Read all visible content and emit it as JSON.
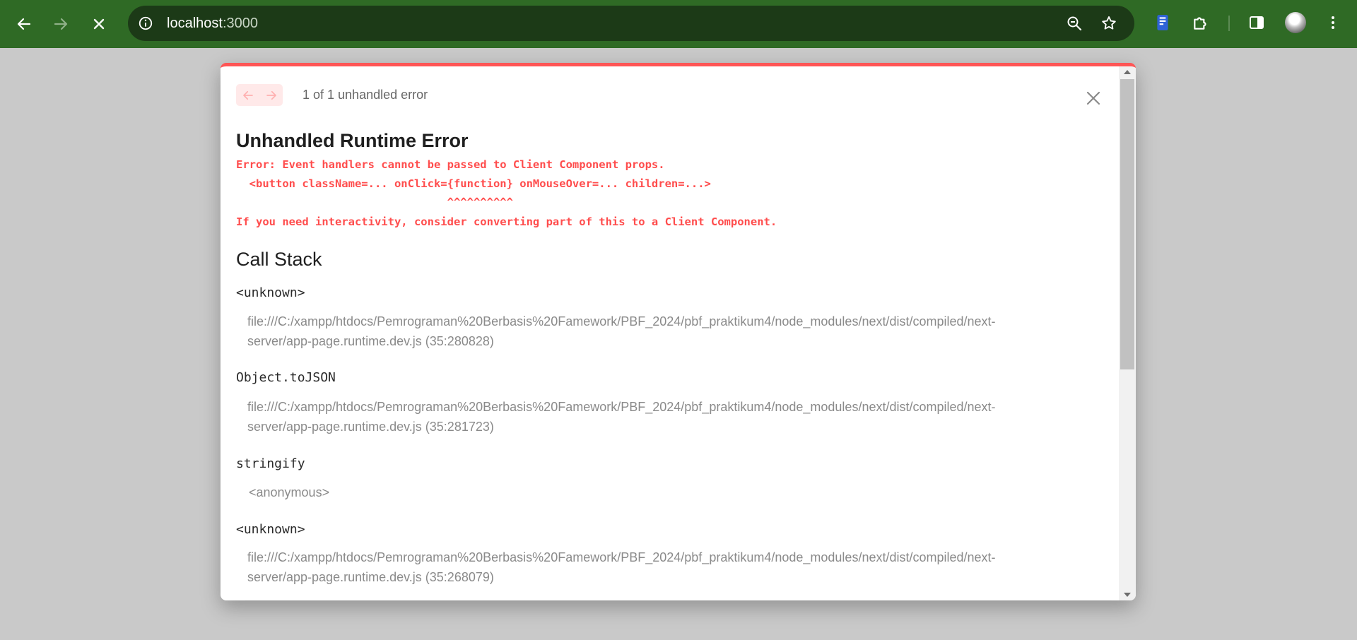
{
  "browser": {
    "url_host": "localhost",
    "url_port": ":3000",
    "icons": {
      "back": "arrow-left-icon",
      "forward": "arrow-right-icon",
      "stop": "close-icon",
      "site_info": "info-icon",
      "zoom": "zoom-out-icon",
      "bookmark": "star-icon",
      "extension_reader": "book-icon",
      "extensions": "puzzle-icon",
      "side_panel": "side-panel-icon",
      "profile": "avatar",
      "menu": "kebab-menu-icon"
    },
    "toolbar_color": "#2f6a25"
  },
  "dialog": {
    "error_count": "1 of 1 unhandled error",
    "title": "Unhandled Runtime Error",
    "error_lines": [
      "Error: Event handlers cannot be passed to Client Component props.",
      "  <button className=... onClick={function} onMouseOver=... children=...>",
      "                                ^^^^^^^^^^",
      "If you need interactivity, consider converting part of this to a Client Component."
    ],
    "call_stack_heading": "Call Stack",
    "frames": [
      {
        "function": "<unknown>",
        "location": "file:///C:/xampp/htdocs/Pemrograman%20Berbasis%20Famework/PBF_2024/pbf_praktikum4/node_modules/next/dist/compiled/next-server/app-page.runtime.dev.js (35:280828)"
      },
      {
        "function": "Object.toJSON",
        "location": "file:///C:/xampp/htdocs/Pemrograman%20Berbasis%20Famework/PBF_2024/pbf_praktikum4/node_modules/next/dist/compiled/next-server/app-page.runtime.dev.js (35:281723)"
      },
      {
        "function": "stringify",
        "location": "<anonymous>"
      },
      {
        "function": "<unknown>",
        "location": "file:///C:/xampp/htdocs/Pemrograman%20Berbasis%20Famework/PBF_2024/pbf_praktikum4/node_modules/next/dist/compiled/next-server/app-page.runtime.dev.js (35:268079)"
      }
    ],
    "accent_color": "#ff5555"
  }
}
